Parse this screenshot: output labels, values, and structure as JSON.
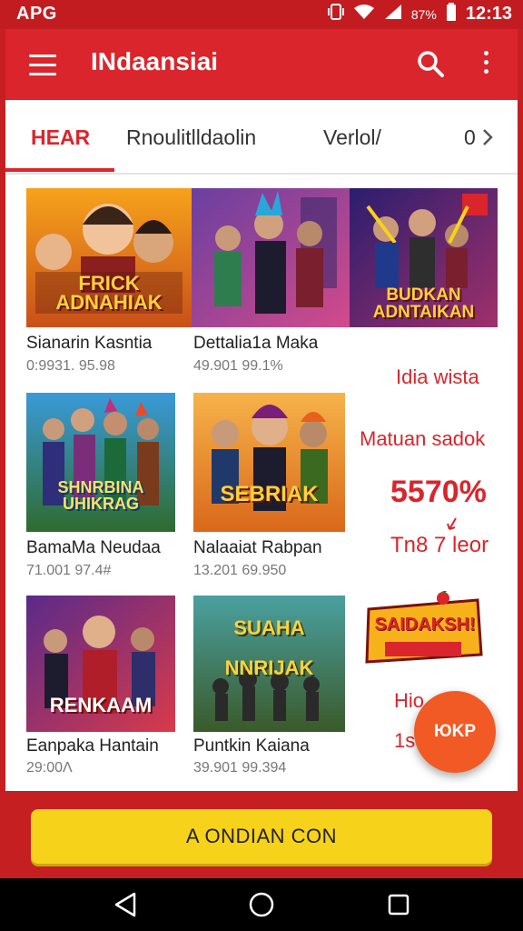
{
  "status_bar": {
    "carrier": "APG",
    "battery": "87%",
    "time": "12:13"
  },
  "app_bar": {
    "title": "INdaansiai",
    "menu_icon": "hamburger-menu-icon",
    "search_icon": "search-icon",
    "more_icon": "more-vert-icon"
  },
  "tabs": [
    {
      "label": "HEAR",
      "active": true
    },
    {
      "label": "Rnoulitlldaolin",
      "active": false
    },
    {
      "label": "Verlol/",
      "active": false
    },
    {
      "label": "0",
      "active": false
    }
  ],
  "cards": [
    {
      "banner": "FRICK ADNAHIAK",
      "title": "Sianarin Kasntia",
      "stats": "0:9931. 95.98"
    },
    {
      "banner": "",
      "title": "Dettalia1a Maka",
      "stats": "49.901 99.1%"
    },
    {
      "banner": "BUDKAN ADNTAIKAN",
      "title": "",
      "stats": ""
    },
    {
      "banner": "SHNRBINA UHIKRAG",
      "title": "BamaMa Neudaa",
      "stats": "71.001 97.4#"
    },
    {
      "banner": "SEBRIAK",
      "title": "Nalaaiat Rabpan",
      "stats": "13.201 69.950"
    },
    {
      "banner": "RENKAAM",
      "title": "Eanpaka Hantain",
      "stats": "29:00Λ"
    },
    {
      "banner": "SUAHA NNRIJAK",
      "title": "Puntkin Kaiana",
      "stats": "39.901 99.394"
    }
  ],
  "side_panel": {
    "heading": "Idia wista",
    "subheading": "Matuan sadok",
    "percent": "5570%",
    "note": "Tn8 7 leor",
    "logo_text": "SAIDAKSH!",
    "small_label": "Hio",
    "small_value": "1s"
  },
  "fab": {
    "label": "ЮKP"
  },
  "cta": {
    "label": "A ONDIAN CON"
  },
  "colors": {
    "brand_red": "#d9252b",
    "status_red": "#c21c20",
    "cta_yellow": "#f7d21b",
    "fab_orange": "#f15a24"
  }
}
